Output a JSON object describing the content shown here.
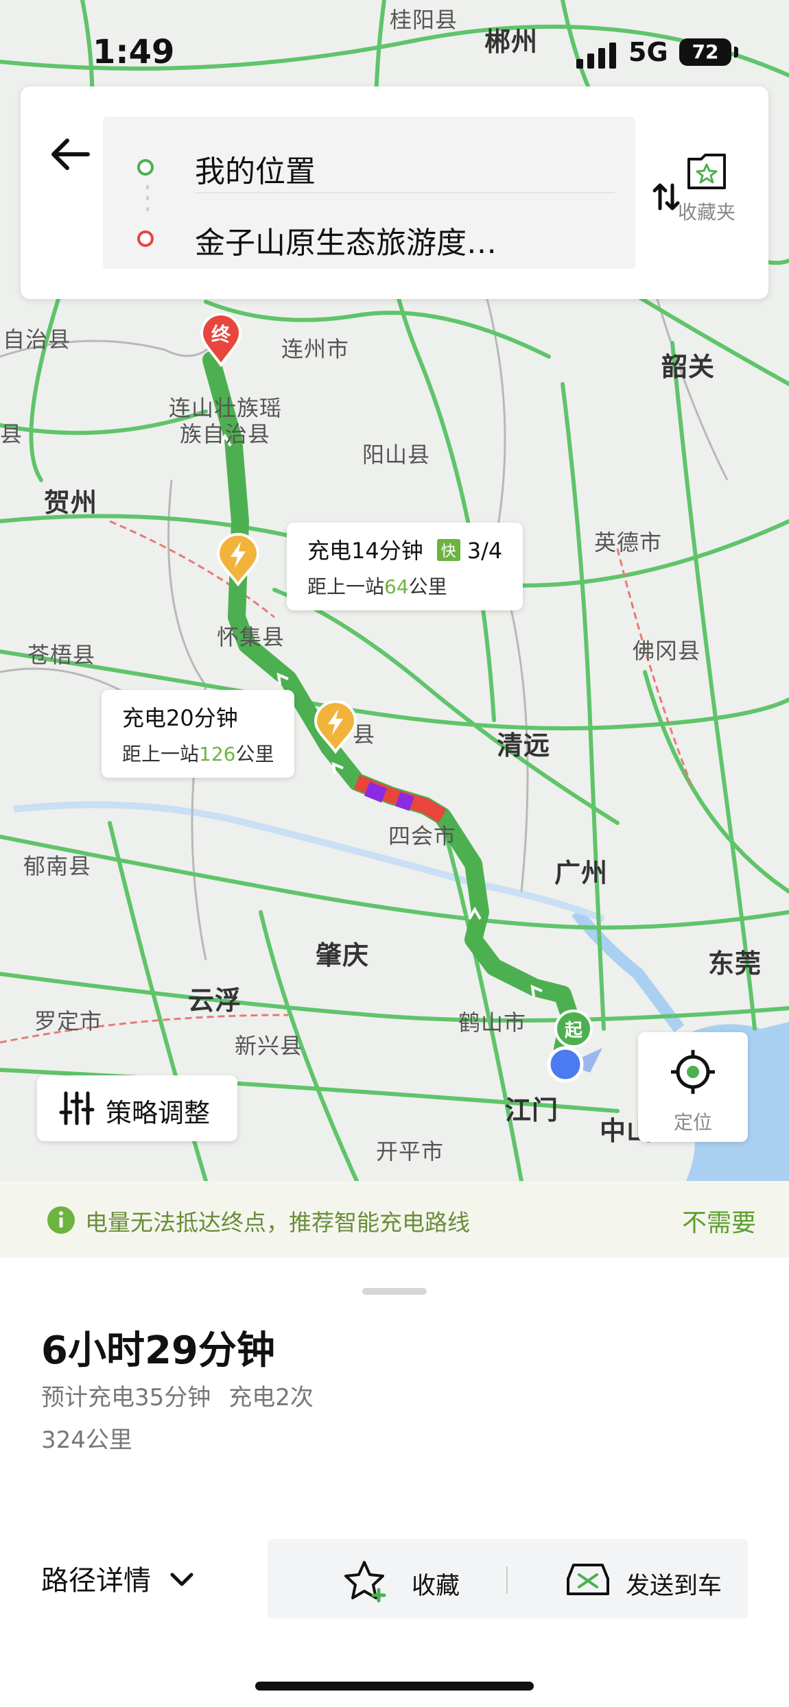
{
  "status": {
    "time": "1:49",
    "network": "5G",
    "battery": "72"
  },
  "search": {
    "origin": "我的位置",
    "destination": "金子山原生态旅游度…",
    "favorites_label": "收藏夹"
  },
  "map": {
    "labels": [
      {
        "text": "桂阳县",
        "kind": "town"
      },
      {
        "text": "郴州",
        "kind": "city"
      },
      {
        "text": "连州市",
        "kind": "town"
      },
      {
        "text": "韶关",
        "kind": "city"
      },
      {
        "text": "自治县",
        "kind": "town"
      },
      {
        "text": "连山壮族瑶",
        "kind": "town"
      },
      {
        "text": "族自治县",
        "kind": "town"
      },
      {
        "text": "阳山县",
        "kind": "town"
      },
      {
        "text": "贺州",
        "kind": "city"
      },
      {
        "text": "英德市",
        "kind": "town"
      },
      {
        "text": "怀集县",
        "kind": "town"
      },
      {
        "text": "苍梧县",
        "kind": "town"
      },
      {
        "text": "佛冈县",
        "kind": "town"
      },
      {
        "text": "县",
        "kind": "town"
      },
      {
        "text": "清远",
        "kind": "city"
      },
      {
        "text": "四会市",
        "kind": "town"
      },
      {
        "text": "广州",
        "kind": "city"
      },
      {
        "text": "郁南县",
        "kind": "town"
      },
      {
        "text": "肇庆",
        "kind": "city"
      },
      {
        "text": "东莞",
        "kind": "city"
      },
      {
        "text": "云浮",
        "kind": "city"
      },
      {
        "text": "罗定市",
        "kind": "town"
      },
      {
        "text": "鹤山市",
        "kind": "town"
      },
      {
        "text": "新兴县",
        "kind": "town"
      },
      {
        "text": "江门",
        "kind": "city"
      },
      {
        "text": "中山",
        "kind": "city"
      },
      {
        "text": "开平市",
        "kind": "town"
      },
      {
        "text": "县",
        "kind": "town"
      }
    ],
    "end_marker": "终",
    "start_marker": "起",
    "charge_stops": [
      {
        "duration": "充电14分钟",
        "fast_badge": "快",
        "count": "3/4",
        "prefix": "距上一站",
        "distance": "64",
        "unit": "公里"
      },
      {
        "duration": "充电20分钟",
        "prefix": "距上一站",
        "distance": "126",
        "unit": "公里"
      }
    ],
    "strategy_label": "策略调整",
    "locate_label": "定位"
  },
  "notice": {
    "text": "电量无法抵达终点，推荐智能充电路线",
    "action": "不需要"
  },
  "summary": {
    "duration": "6小时29分钟",
    "charge_time": "预计充电35分钟",
    "charge_count": "充电2次",
    "distance": "324公里"
  },
  "bottom": {
    "details_label": "路径详情",
    "favorite_label": "收藏",
    "send_label": "发送到车"
  },
  "colors": {
    "accent": "#6db33f",
    "route": "#4cb050",
    "congestion": "#e8453c",
    "severe": "#8a2be2",
    "charge_pin": "#f2b33d",
    "origin_dot": "#4a7bf0"
  }
}
